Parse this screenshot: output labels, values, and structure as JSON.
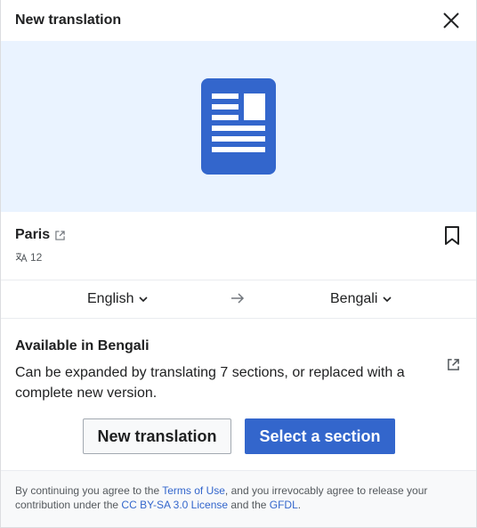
{
  "header": {
    "title": "New translation"
  },
  "article": {
    "name": "Paris",
    "language_count": "12"
  },
  "languages": {
    "source": "English",
    "target": "Bengali"
  },
  "available": {
    "title": "Available in Bengali",
    "description": "Can be expanded by translating 7 sections, or replaced with a complete new version."
  },
  "buttons": {
    "new_translation": "New translation",
    "select_section": "Select a section"
  },
  "footer": {
    "prefix": "By continuing you agree to the ",
    "terms": "Terms of Use",
    "middle": ", and you irrevocably agree to release your contribution under the ",
    "license": "CC BY-SA 3.0 License",
    "and": " and the ",
    "gfdl": "GFDL",
    "end": "."
  },
  "colors": {
    "accent": "#3366cc",
    "hero_bg": "#eaf3ff"
  }
}
